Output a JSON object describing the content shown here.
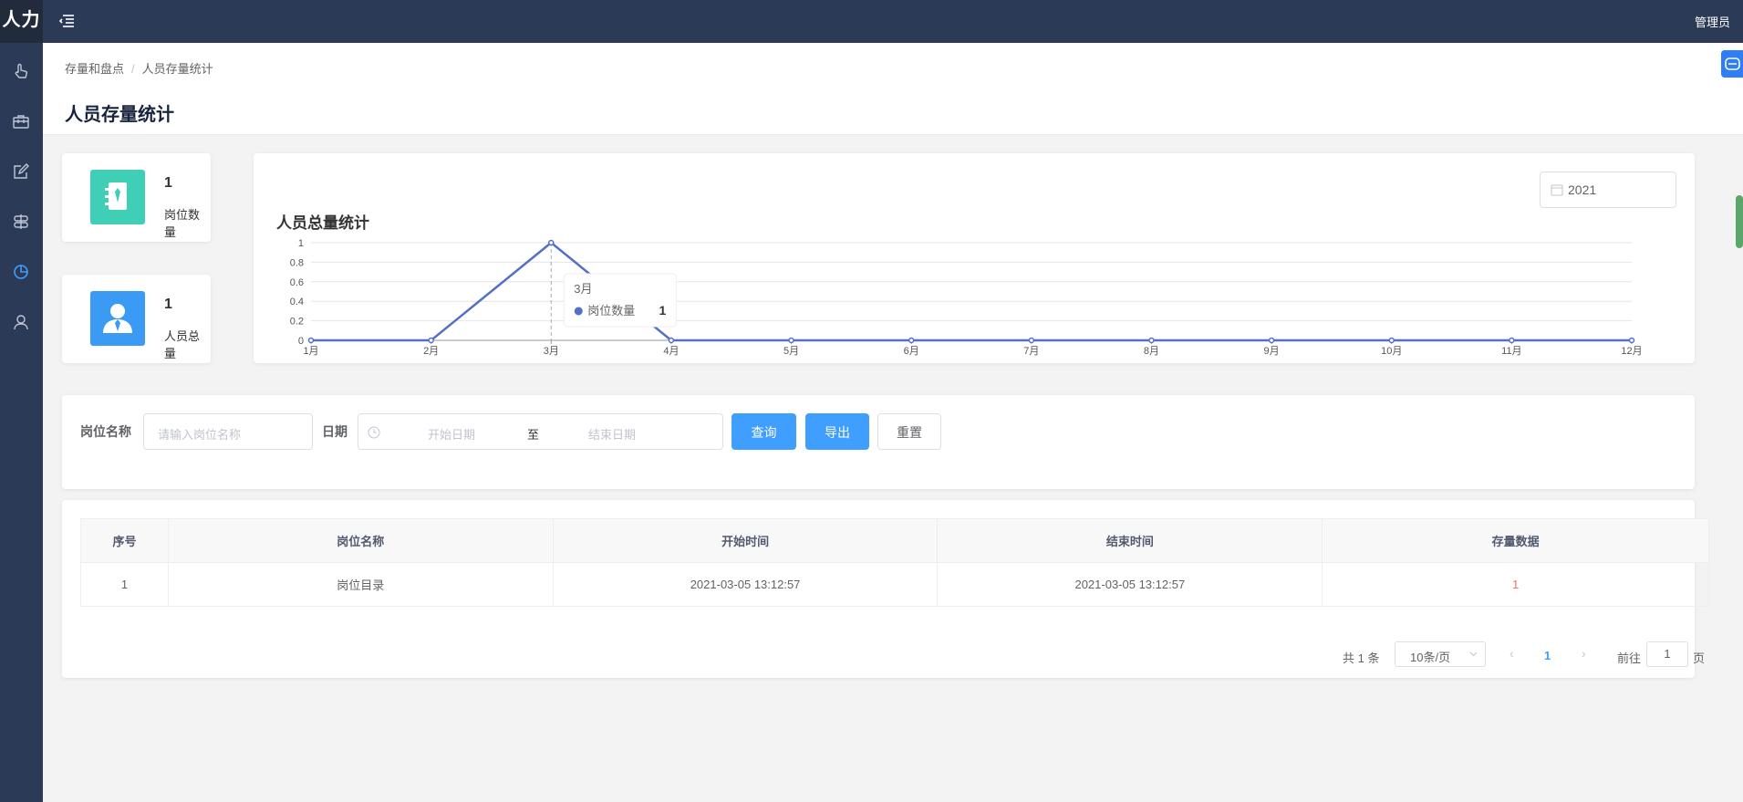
{
  "app": {
    "logo": "人力",
    "user": "管理员"
  },
  "sidebar": {
    "items": [
      {
        "icon": "pointer-hand-icon",
        "active": false
      },
      {
        "icon": "briefcase-icon",
        "active": false
      },
      {
        "icon": "edit-icon",
        "active": false
      },
      {
        "icon": "settings-icon",
        "active": false
      },
      {
        "icon": "pie-chart-icon",
        "active": true
      },
      {
        "icon": "user-icon",
        "active": false
      }
    ]
  },
  "breadcrumb": {
    "parent": "存量和盘点",
    "separator": "/",
    "current": "人员存量统计"
  },
  "page": {
    "title": "人员存量统计"
  },
  "stats": [
    {
      "value": "1",
      "label": "岗位数量",
      "icon": "id-badge-icon",
      "color": "#3ecfb6"
    },
    {
      "value": "1",
      "label": "人员总量",
      "icon": "person-icon",
      "color": "#3a9af4"
    }
  ],
  "chart_section": {
    "year": "2021"
  },
  "chart_data": {
    "type": "line",
    "title": "人员总量统计",
    "categories": [
      "1月",
      "2月",
      "3月",
      "4月",
      "5月",
      "6月",
      "7月",
      "8月",
      "9月",
      "10月",
      "11月",
      "12月"
    ],
    "series": [
      {
        "name": "岗位数量",
        "values": [
          0,
          0,
          1,
          0,
          0,
          0,
          0,
          0,
          0,
          0,
          0,
          0
        ],
        "color": "#5470c6"
      }
    ],
    "ylim": [
      0,
      1
    ],
    "yticks": [
      "0",
      "0.2",
      "0.4",
      "0.6",
      "0.8",
      "1"
    ],
    "grid": true,
    "tooltip": {
      "category": "3月",
      "series": "岗位数量",
      "value": "1"
    }
  },
  "filter": {
    "post_label": "岗位名称",
    "post_placeholder": "请输入岗位名称",
    "date_label": "日期",
    "start_placeholder": "开始日期",
    "range_sep": "至",
    "end_placeholder": "结束日期",
    "query": "查询",
    "export": "导出",
    "reset": "重置"
  },
  "table": {
    "headers": [
      "序号",
      "岗位名称",
      "开始时间",
      "结束时间",
      "存量数据"
    ],
    "rows": [
      [
        "1",
        "岗位目录",
        "2021-03-05 13:12:57",
        "2021-03-05 13:12:57",
        "1"
      ]
    ]
  },
  "pagination": {
    "total": "共 1 条",
    "page_size": "10条/页",
    "current": "1",
    "goto_label": "前往",
    "goto_value": "1",
    "page_unit": "页"
  }
}
